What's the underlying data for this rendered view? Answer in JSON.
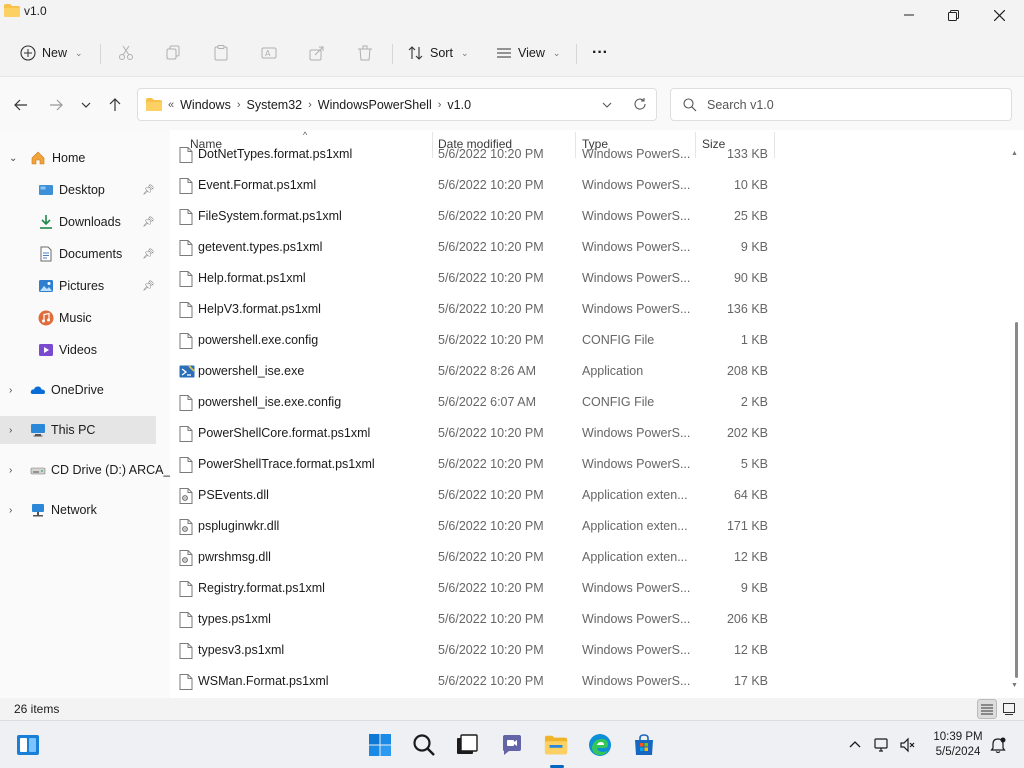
{
  "window": {
    "title": "v1.0",
    "icons": {
      "folder": "folder-icon",
      "minimize": "minimize-icon",
      "maximize": "maximize-icon",
      "close": "close-icon"
    }
  },
  "commandbar": {
    "new_label": "New",
    "sort_label": "Sort",
    "view_label": "View",
    "more_label": "···"
  },
  "address": {
    "overflow": "«",
    "crumbs": [
      "Windows",
      "System32",
      "WindowsPowerShell",
      "v1.0"
    ],
    "search_placeholder": "Search v1.0"
  },
  "sidebar": {
    "items": [
      {
        "label": "Home",
        "icon": "home-icon"
      },
      {
        "label": "Desktop",
        "icon": "desktop-icon"
      },
      {
        "label": "Downloads",
        "icon": "downloads-icon"
      },
      {
        "label": "Documents",
        "icon": "documents-icon"
      },
      {
        "label": "Pictures",
        "icon": "pictures-icon"
      },
      {
        "label": "Music",
        "icon": "music-icon"
      },
      {
        "label": "Videos",
        "icon": "videos-icon"
      },
      {
        "label": "OneDrive",
        "icon": "onedrive-icon"
      },
      {
        "label": "This PC",
        "icon": "this-pc-icon"
      },
      {
        "label": "CD Drive (D:) ARCA_",
        "icon": "cd-drive-icon"
      },
      {
        "label": "Network",
        "icon": "network-icon"
      }
    ]
  },
  "columns": {
    "name": "Name",
    "date": "Date modified",
    "type": "Type",
    "size": "Size"
  },
  "files": [
    {
      "name": "DotNetTypes.format.ps1xml",
      "date": "5/6/2022 10:20 PM",
      "type": "Windows PowerS...",
      "size": "133 KB",
      "icon": "file-icon"
    },
    {
      "name": "Event.Format.ps1xml",
      "date": "5/6/2022 10:20 PM",
      "type": "Windows PowerS...",
      "size": "10 KB",
      "icon": "file-icon"
    },
    {
      "name": "FileSystem.format.ps1xml",
      "date": "5/6/2022 10:20 PM",
      "type": "Windows PowerS...",
      "size": "25 KB",
      "icon": "file-icon"
    },
    {
      "name": "getevent.types.ps1xml",
      "date": "5/6/2022 10:20 PM",
      "type": "Windows PowerS...",
      "size": "9 KB",
      "icon": "file-icon"
    },
    {
      "name": "Help.format.ps1xml",
      "date": "5/6/2022 10:20 PM",
      "type": "Windows PowerS...",
      "size": "90 KB",
      "icon": "file-icon"
    },
    {
      "name": "HelpV3.format.ps1xml",
      "date": "5/6/2022 10:20 PM",
      "type": "Windows PowerS...",
      "size": "136 KB",
      "icon": "file-icon"
    },
    {
      "name": "powershell.exe.config",
      "date": "5/6/2022 10:20 PM",
      "type": "CONFIG File",
      "size": "1 KB",
      "icon": "file-icon"
    },
    {
      "name": "powershell_ise.exe",
      "date": "5/6/2022 8:26 AM",
      "type": "Application",
      "size": "208 KB",
      "icon": "app-icon"
    },
    {
      "name": "powershell_ise.exe.config",
      "date": "5/6/2022 6:07 AM",
      "type": "CONFIG File",
      "size": "2 KB",
      "icon": "file-icon"
    },
    {
      "name": "PowerShellCore.format.ps1xml",
      "date": "5/6/2022 10:20 PM",
      "type": "Windows PowerS...",
      "size": "202 KB",
      "icon": "file-icon"
    },
    {
      "name": "PowerShellTrace.format.ps1xml",
      "date": "5/6/2022 10:20 PM",
      "type": "Windows PowerS...",
      "size": "5 KB",
      "icon": "file-icon"
    },
    {
      "name": "PSEvents.dll",
      "date": "5/6/2022 10:20 PM",
      "type": "Application exten...",
      "size": "64 KB",
      "icon": "dll-icon"
    },
    {
      "name": "pspluginwkr.dll",
      "date": "5/6/2022 10:20 PM",
      "type": "Application exten...",
      "size": "171 KB",
      "icon": "dll-icon"
    },
    {
      "name": "pwrshmsg.dll",
      "date": "5/6/2022 10:20 PM",
      "type": "Application exten...",
      "size": "12 KB",
      "icon": "dll-icon"
    },
    {
      "name": "Registry.format.ps1xml",
      "date": "5/6/2022 10:20 PM",
      "type": "Windows PowerS...",
      "size": "9 KB",
      "icon": "file-icon"
    },
    {
      "name": "types.ps1xml",
      "date": "5/6/2022 10:20 PM",
      "type": "Windows PowerS...",
      "size": "206 KB",
      "icon": "file-icon"
    },
    {
      "name": "typesv3.ps1xml",
      "date": "5/6/2022 10:20 PM",
      "type": "Windows PowerS...",
      "size": "12 KB",
      "icon": "file-icon"
    },
    {
      "name": "WSMan.Format.ps1xml",
      "date": "5/6/2022 10:20 PM",
      "type": "Windows PowerS...",
      "size": "17 KB",
      "icon": "file-icon"
    }
  ],
  "status": {
    "item_count": "26 items"
  },
  "taskbar": {
    "time": "10:39 PM",
    "date": "5/5/2024",
    "apps": [
      "widgets-icon",
      "start-icon",
      "search-icon",
      "task-view-icon",
      "chat-icon",
      "file-explorer-icon",
      "edge-icon",
      "store-icon"
    ],
    "tray": [
      "chevron-up-icon",
      "network-tray-icon",
      "volume-icon",
      "notification-icon"
    ]
  },
  "colors": {
    "accent": "#0067c0",
    "folder": "#f8c14a",
    "selected": "#e5e5e5"
  }
}
